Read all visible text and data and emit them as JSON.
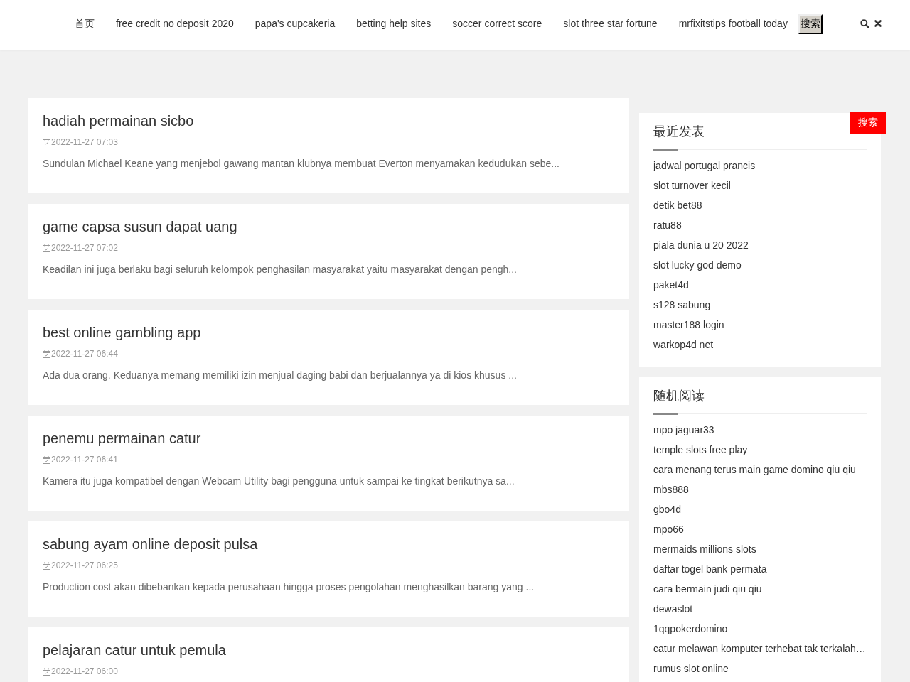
{
  "header": {
    "nav_items": [
      {
        "label": "首页"
      },
      {
        "label": "free credit no deposit 2020"
      },
      {
        "label": "papa's cupcakeria"
      },
      {
        "label": "betting help sites"
      },
      {
        "label": "soccer correct score"
      },
      {
        "label": "slot three star fortune"
      },
      {
        "label": "mrfixitstips football today"
      }
    ],
    "search_button": "搜索"
  },
  "posts": [
    {
      "title": "hadiah permainan sicbo",
      "date": "2022-11-27 07:03",
      "excerpt": "Sundulan Michael Keane yang menjebol gawang mantan klubnya membuat Everton menyamakan kedudukan sebe..."
    },
    {
      "title": "game capsa susun dapat uang",
      "date": "2022-11-27 07:02",
      "excerpt": "Keadilan ini juga berlaku bagi seluruh kelompok penghasilan masyarakat yaitu masyarakat dengan pengh..."
    },
    {
      "title": "best online gambling app",
      "date": "2022-11-27 06:44",
      "excerpt": "Ada dua orang. Keduanya memang memiliki izin menjual daging babi dan berjualannya ya di kios khusus ..."
    },
    {
      "title": "penemu permainan catur",
      "date": "2022-11-27 06:41",
      "excerpt": "Kamera itu juga kompatibel dengan Webcam Utility bagi pengguna untuk sampai ke tingkat berikutnya sa..."
    },
    {
      "title": "sabung ayam online deposit pulsa",
      "date": "2022-11-27 06:25",
      "excerpt": "Production cost akan dibebankan kepada perusahaan hingga proses pengolahan menghasilkan barang yang ..."
    },
    {
      "title": "pelajaran catur untuk pemula",
      "date": "2022-11-27 06:00"
    }
  ],
  "sidebar": {
    "search_button": "搜索",
    "widgets": [
      {
        "title": "最近发表",
        "links": [
          "jadwal portugal prancis",
          "slot turnover kecil",
          "detik bet88",
          "ratu88",
          "piala dunia u 20 2022",
          "slot lucky god demo",
          "paket4d",
          "s128 sabung",
          "master188 login",
          "warkop4d net"
        ]
      },
      {
        "title": "随机阅读",
        "links": [
          "mpo jaguar33",
          "temple slots free play",
          "cara menang terus main game domino qiu qiu",
          "mbs888",
          "gbo4d",
          "mpo66",
          "mermaids millions slots",
          "daftar togel bank permata",
          "cara bermain judi qiu qiu",
          "dewaslot",
          "1qqpokerdomino",
          "catur melawan komputer terhebat tak terkalah…",
          "rumus slot online"
        ]
      }
    ]
  }
}
